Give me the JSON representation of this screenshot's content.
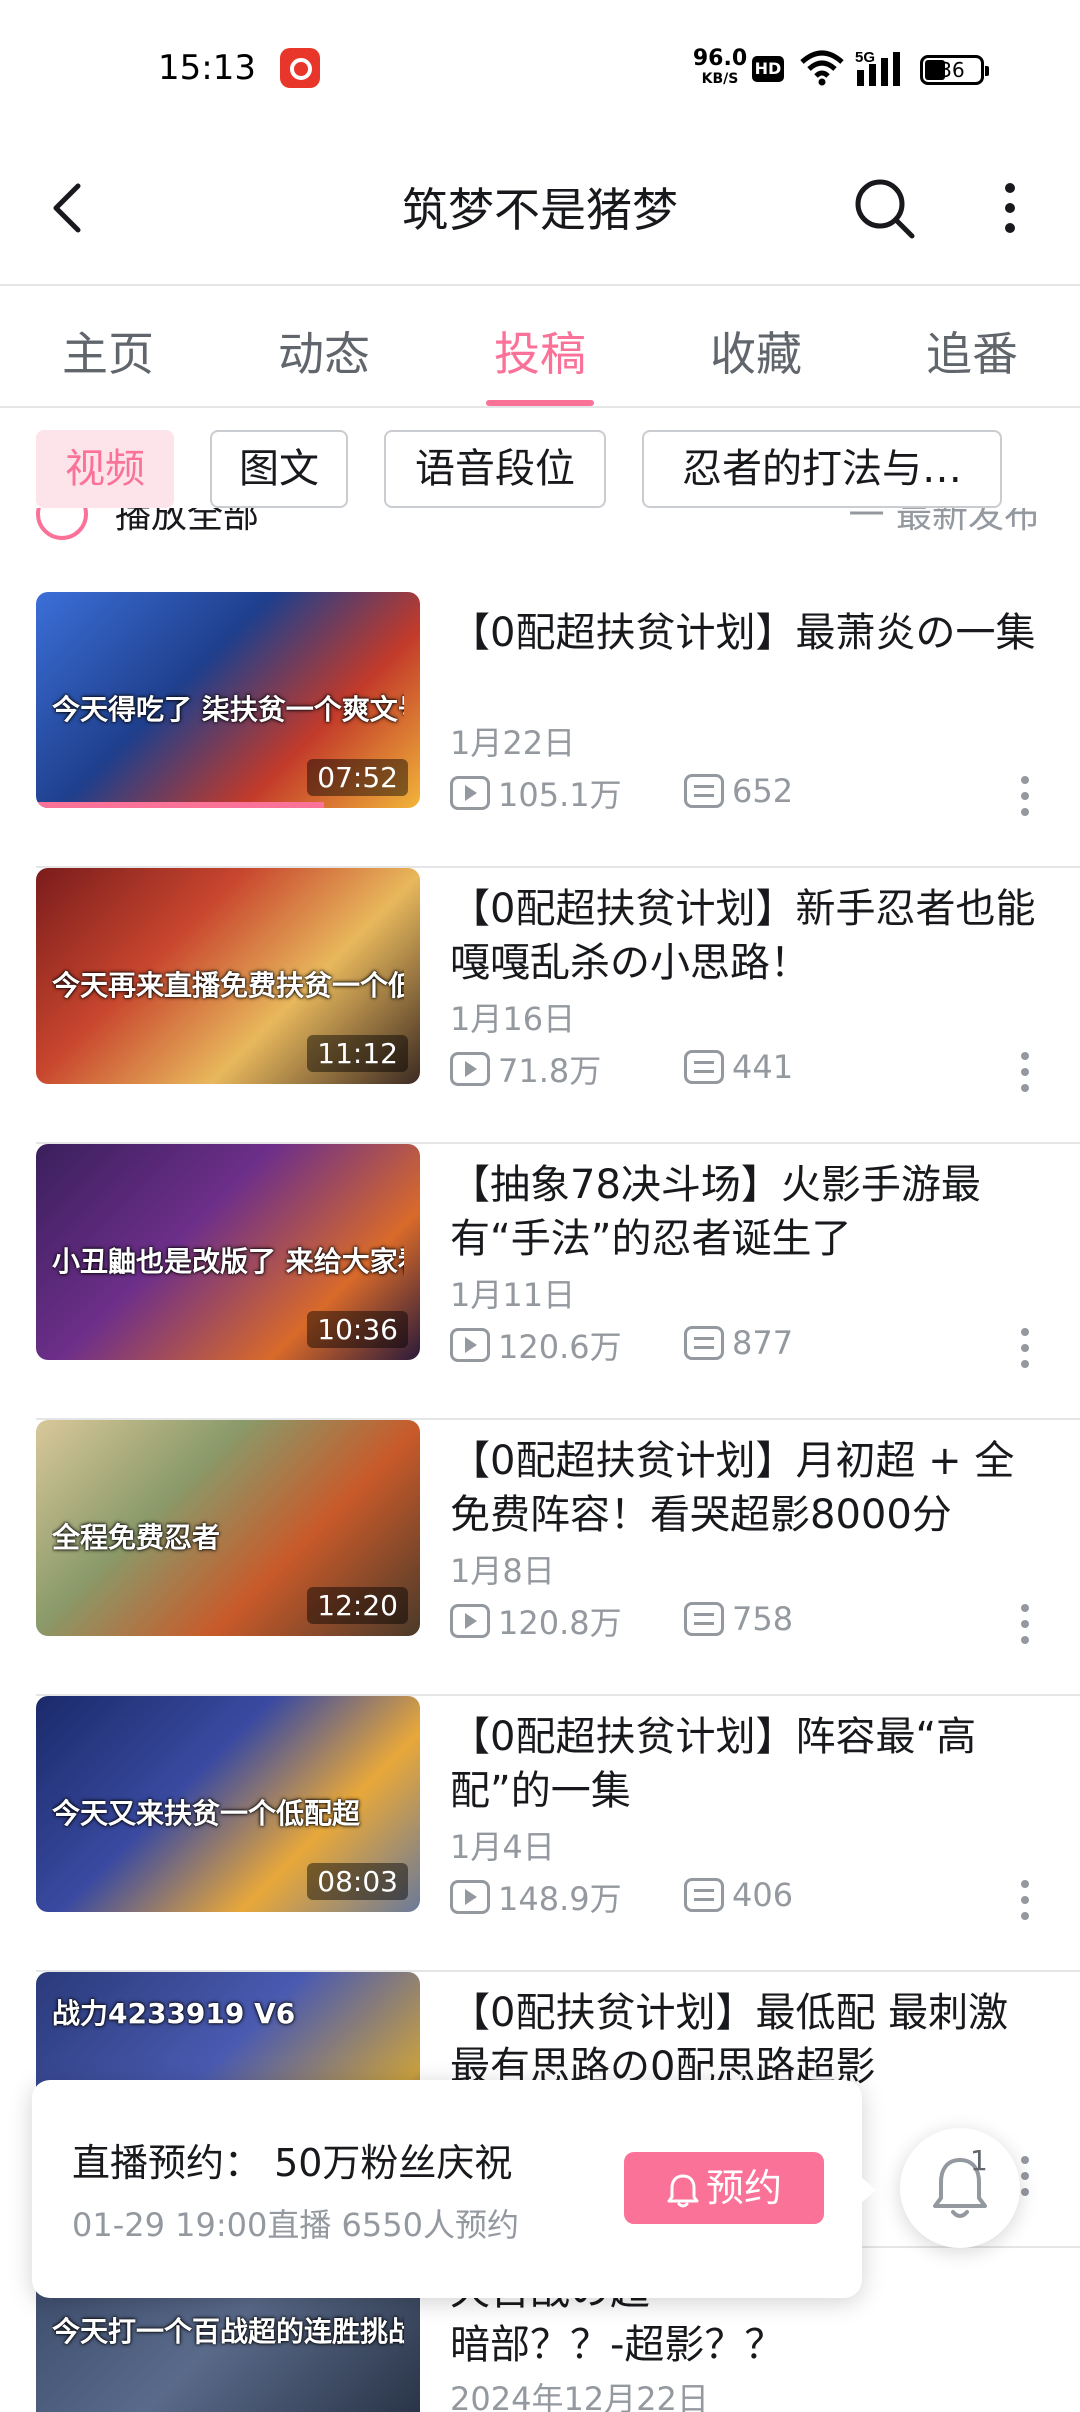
{
  "status_bar": {
    "time": "15:13",
    "net_speed_value": "96.0",
    "net_speed_unit": "KB/S",
    "hd": "HD",
    "network": "5G",
    "battery": "36",
    "notif_app_color": "#e8362a"
  },
  "header": {
    "title": "筑梦不是猪梦"
  },
  "tabs": [
    {
      "label": "主页",
      "active": false
    },
    {
      "label": "动态",
      "active": false
    },
    {
      "label": "投稿",
      "active": true
    },
    {
      "label": "收藏",
      "active": false
    },
    {
      "label": "追番",
      "active": false
    }
  ],
  "filters": [
    {
      "label": "视频",
      "active": true
    },
    {
      "label": "图文",
      "active": false
    },
    {
      "label": "语音段位",
      "active": false
    },
    {
      "label": "忍者的打法与…",
      "active": false
    }
  ],
  "sort_row": {
    "play_all": "播放全部",
    "sort": "一 最新发布"
  },
  "videos": [
    {
      "title": "【0配超扶贫计划】最萧炎の一集",
      "date": "1月22日",
      "views": "105.1万",
      "danmaku": "652",
      "duration": "07:52",
      "thumb_caption": "今天得吃了 柒扶贫一个爽文号",
      "watched_progress": 0.75
    },
    {
      "title": "【0配超扶贫计划】新手忍者也能嘎嘎乱杀の小思路！",
      "date": "1月16日",
      "views": "71.8万",
      "danmaku": "441",
      "duration": "11:12",
      "thumb_caption": "今天再来直播免费扶贫一个低配超影的号"
    },
    {
      "title": "【抽象78决斗场】火影手游最有“手法”的忍者诞生了",
      "date": "1月11日",
      "views": "120.6万",
      "danmaku": "877",
      "duration": "10:36",
      "thumb_caption": "小丑鼬也是改版了 来给大家看看这变态的强度"
    },
    {
      "title": "【0配超扶贫计划】月初超 + 全免费阵容！看哭超影8000分",
      "date": "1月8日",
      "views": "120.8万",
      "danmaku": "758",
      "duration": "12:20",
      "thumb_caption": "全程免费忍者"
    },
    {
      "title": "【0配超扶贫计划】阵容最“高配”的一集",
      "date": "1月4日",
      "views": "148.9万",
      "danmaku": "406",
      "duration": "08:03",
      "thumb_caption": "今天又来扶贫一个低配超"
    },
    {
      "title": "【0配扶贫计划】最低配 最刺激 最有思路の0配思路超影",
      "date": "",
      "views": "",
      "danmaku": "",
      "duration": "",
      "thumb_caption": "战力4233919 V6"
    },
    {
      "title": "暗部？？-超影？？",
      "title_prefix_visible": "天百战の超",
      "date": "2024年12月22日",
      "views": "",
      "danmaku": "",
      "duration": "",
      "thumb_caption": "今天打一个百战超的连胜挑战"
    }
  ],
  "live_popup": {
    "title": "直播预约：  50万粉丝庆祝",
    "subtitle": "01-29 19:00直播 6550人预约",
    "button": "预约",
    "bell_count": "1"
  },
  "colors": {
    "accent": "#fb7299",
    "text": "#18191c",
    "muted": "#9499a0"
  }
}
